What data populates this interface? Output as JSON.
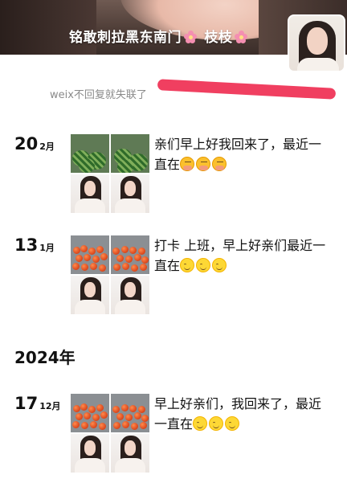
{
  "header": {
    "cover_title": "铭敢刺拉黑东南门",
    "cover_title_suffix": "枝枝",
    "signature": "weix不回复就失联了"
  },
  "colors": {
    "redaction": "#ee2a4f",
    "flower_emoji": "#f48fb1"
  },
  "year_divider": "2024年",
  "posts": [
    {
      "day": "20",
      "month": "2月",
      "text": "亲们早上好我回来了，最近一直在",
      "emoji": [
        "shushing-face",
        "shushing-face",
        "shushing-face"
      ],
      "images": [
        "watermelons",
        "watermelons",
        "selfie",
        "selfie"
      ]
    },
    {
      "day": "13",
      "month": "1月",
      "text": "打卡 上班，早上好亲们最近一直在",
      "emoji": [
        "smiling-face",
        "smiling-face",
        "smiling-face"
      ],
      "images": [
        "tomatoes",
        "tomatoes",
        "selfie",
        "selfie"
      ]
    },
    {
      "day": "17",
      "month": "12月",
      "text": "早上好亲们，我回来了，最近一直在",
      "emoji": [
        "smiling-face",
        "smiling-face",
        "smiling-face"
      ],
      "images": [
        "tomatoes",
        "tomatoes",
        "selfie",
        "selfie"
      ]
    }
  ]
}
